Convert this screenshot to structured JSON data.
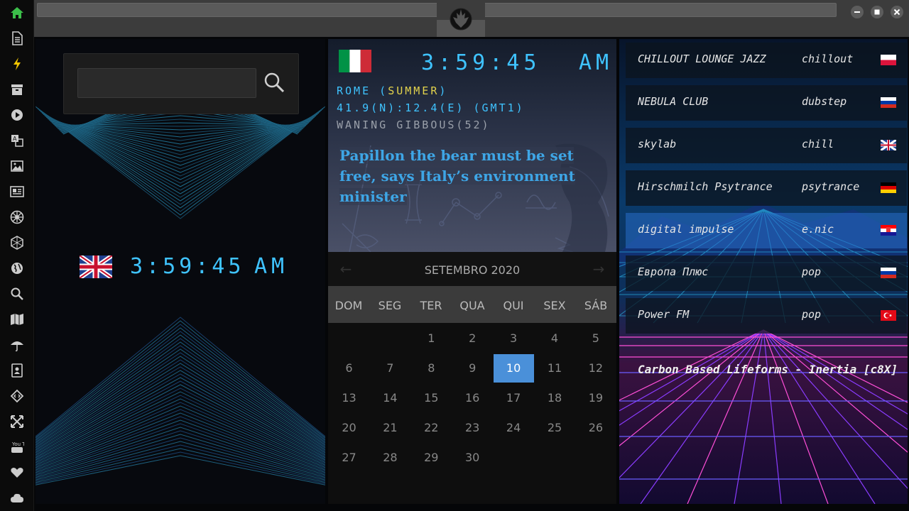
{
  "sidebar": {
    "items": [
      {
        "icon": "home-icon",
        "color": "#3cbf4a"
      },
      {
        "icon": "document-icon"
      },
      {
        "icon": "lightning-icon",
        "color": "#f2c500"
      },
      {
        "icon": "archive-icon"
      },
      {
        "icon": "play-circle-icon"
      },
      {
        "icon": "translate-icon"
      },
      {
        "icon": "image-icon"
      },
      {
        "icon": "newspaper-icon"
      },
      {
        "icon": "galactic-empire-icon"
      },
      {
        "icon": "hexagon-icon"
      },
      {
        "icon": "globe-icon"
      },
      {
        "icon": "search-icon"
      },
      {
        "icon": "map-icon"
      },
      {
        "icon": "umbrella-icon"
      },
      {
        "icon": "contact-book-icon"
      },
      {
        "icon": "code-diamond-icon"
      },
      {
        "icon": "expand-arrows-icon"
      },
      {
        "icon": "youtube-icon",
        "label": "You Tube"
      },
      {
        "icon": "heart-icon"
      },
      {
        "icon": "cloud-icon"
      }
    ]
  },
  "window": {
    "logo": "rebel-alliance-icon"
  },
  "left_clock": {
    "flag": "uk-flag",
    "time": "3:59:45",
    "ampm": "AM"
  },
  "main_clock": {
    "flag": "italy-flag",
    "time": "3:59:45",
    "ampm": "AM",
    "location_prefix": "ROME (",
    "location_season": "SUMMER",
    "location_suffix": ")",
    "coordinates": "41.9(N):12.4(E) (GMT1)",
    "moon": "WANING GIBBOUS(52)"
  },
  "news": {
    "headline": "Papillon the bear must be set free, says Italy’s environment minister"
  },
  "calendar": {
    "month": "SETEMBRO 2020",
    "weekdays": [
      "DOM",
      "SEG",
      "TER",
      "QUA",
      "QUI",
      "SEX",
      "SÁB"
    ],
    "selected_day": 10,
    "first_weekday": 2,
    "days_in_month": 30
  },
  "radio": {
    "stations": [
      {
        "name": "CHILLOUT LOUNGE JAZZ",
        "genre": "chillout",
        "flag": "poland-flag"
      },
      {
        "name": "NEBULA CLUB",
        "genre": "dubstep",
        "flag": "russia-flag"
      },
      {
        "name": "skylab",
        "genre": "chill",
        "flag": "uk-flag"
      },
      {
        "name": "Hirschmilch Psytrance",
        "genre": "psytrance",
        "flag": "germany-flag"
      },
      {
        "name": "digital impulse",
        "genre": "e.nic",
        "flag": "croatia-flag",
        "active": true
      },
      {
        "name": "Европа Плюс",
        "genre": "pop",
        "flag": "russia-flag"
      },
      {
        "name": "Power FM",
        "genre": "pop",
        "flag": "turkey-flag"
      }
    ],
    "now_playing": "Carbon Based Lifeforms - Inertia [c8X]"
  },
  "colors": {
    "clock": "#3fc3ff",
    "news": "#3ea6e6",
    "accent_yellow": "#e2d24c",
    "selected_day": "#4a90d9"
  }
}
